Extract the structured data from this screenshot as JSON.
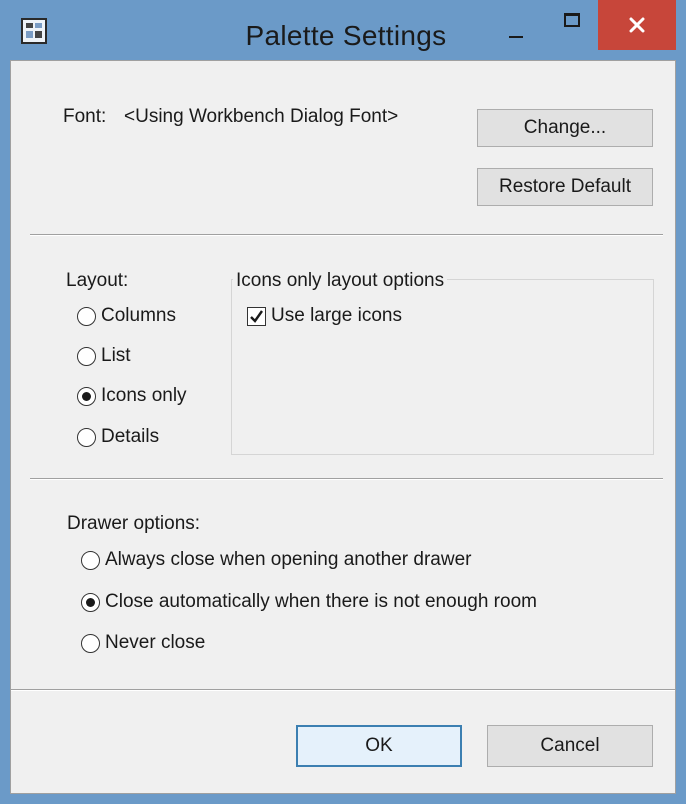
{
  "window": {
    "title": "Palette Settings"
  },
  "font_section": {
    "font_label": "Font:",
    "font_value": "<Using Workbench Dialog Font>",
    "change_button": "Change...",
    "restore_button": "Restore Default"
  },
  "layout": {
    "label": "Layout:",
    "options": [
      {
        "label": "Columns",
        "selected": false
      },
      {
        "label": "List",
        "selected": false
      },
      {
        "label": "Icons only",
        "selected": true
      },
      {
        "label": "Details",
        "selected": false
      }
    ],
    "group_title": "Icons only layout options",
    "use_large_icons": {
      "label": "Use large icons",
      "checked": true
    }
  },
  "drawer": {
    "label": "Drawer options:",
    "options": [
      {
        "label": "Always close when opening another drawer",
        "selected": false
      },
      {
        "label": "Close automatically when there is not enough room",
        "selected": true
      },
      {
        "label": "Never close",
        "selected": false
      }
    ]
  },
  "buttons": {
    "ok": "OK",
    "cancel": "Cancel"
  },
  "colors": {
    "titlebar": "#6b9ac8",
    "close_button": "#c7463a",
    "client_background": "#f0f0f0"
  }
}
